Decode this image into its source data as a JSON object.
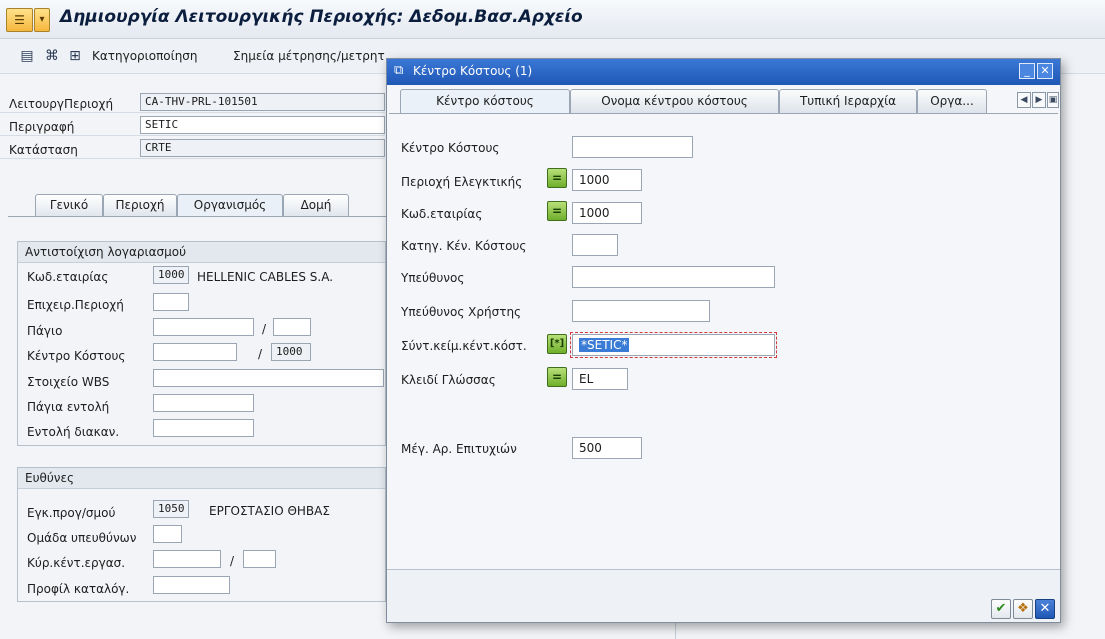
{
  "window": {
    "title": "Δημιουργία Λειτουργικής Περιοχής: Δεδομ.Βασ.Αρχείο"
  },
  "toolbar": {
    "items": [
      "Κατηγοριοποίηση",
      "Σημεία μέτρησης/μετρητ"
    ]
  },
  "header": {
    "fields": [
      {
        "label": "ΛειτουργΠεριοχή",
        "value": "CA-THV-PRL-101501"
      },
      {
        "label": "Περιγραφή",
        "value": "SETIC"
      },
      {
        "label": "Κατάσταση",
        "value": "CRTE"
      }
    ]
  },
  "main_tabs": [
    "Γενικό",
    "Περιοχή",
    "Οργανισμός",
    "Δομή"
  ],
  "account_group": {
    "title": "Αντιστοίχιση λογαριασμού",
    "company_code": {
      "label": "Κωδ.εταιρίας",
      "value": "1000",
      "text": "HELLENIC CABLES S.A."
    },
    "business_area": {
      "label": "Επιχειρ.Περιοχή",
      "value": ""
    },
    "asset": {
      "label": "Πάγιο",
      "value": "",
      "sub": ""
    },
    "cost_center": {
      "label": "Κέντρο Κόστους",
      "value": "",
      "sub": "1000"
    },
    "wbs": {
      "label": "Στοιχείο WBS",
      "value": ""
    },
    "asset_order": {
      "label": "Πάγια εντολή",
      "value": ""
    },
    "standing_order": {
      "label": "Εντολή διακαν.",
      "value": ""
    }
  },
  "resp_group": {
    "title": "Ευθύνες",
    "planning_plant": {
      "label": "Εγκ.προγ/σμού",
      "value": "1050",
      "text": "ΕΡΓΟΣΤΑΣΙΟ ΘΗΒΑΣ"
    },
    "planner_group": {
      "label": "Ομάδα υπευθύνων",
      "value": ""
    },
    "work_center": {
      "label": "Κύρ.κέντ.εργασ.",
      "value": "",
      "sub": ""
    },
    "catalog_profile": {
      "label": "Προφίλ καταλόγ.",
      "value": ""
    }
  },
  "dialog": {
    "title": "Κέντρο Κόστους (1)",
    "tabs": [
      "Κέντρο κόστους",
      "Ονομα κέντρου κόστους",
      "Τυπική Ιεραρχία",
      "Οργα..."
    ],
    "fields": {
      "cost_center": {
        "label": "Κέντρο Κόστους",
        "value": ""
      },
      "controlling_area": {
        "label": "Περιοχή Ελεγκτικής",
        "value": "1000"
      },
      "company_code": {
        "label": "Κωδ.εταιρίας",
        "value": "1000"
      },
      "category": {
        "label": "Κατηγ. Κέν. Κόστους",
        "value": ""
      },
      "responsible": {
        "label": "Υπεύθυνος",
        "value": ""
      },
      "responsible_user": {
        "label": "Υπεύθυνος Χρήστης",
        "value": ""
      },
      "short_text": {
        "label": "Σύντ.κείμ.κέντ.κόστ.",
        "value": "*SETIC*"
      },
      "language": {
        "label": "Κλειδί Γλώσσας",
        "value": "EL"
      },
      "max_hits": {
        "label": "Μέγ. Αρ. Επιτυχιών",
        "value": "500"
      }
    }
  },
  "colors": {
    "dialog_title_bar": "#2a64c4",
    "selection_highlight": "#3a7bd5",
    "op_button": "#7cbd34",
    "required_marker": "#d13a3a"
  },
  "icons": [
    "menu-icon",
    "dropdown-icon",
    "overview-icon",
    "hierarchy-icon",
    "structure-icon",
    "dialog-icon",
    "minimize-icon",
    "close-icon",
    "equal-op-icon",
    "pattern-op-icon",
    "confirm-icon",
    "search-help-icon",
    "cancel-icon"
  ]
}
